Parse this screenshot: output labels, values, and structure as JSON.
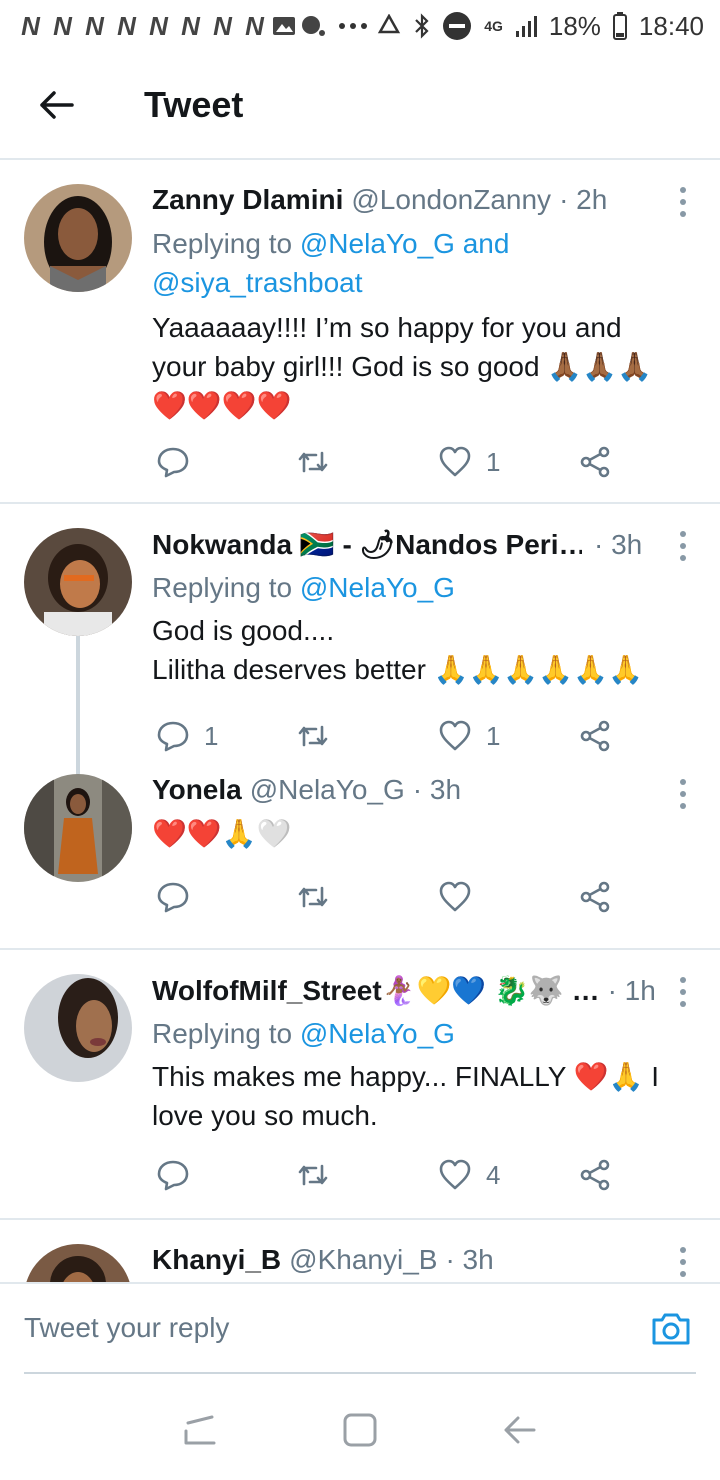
{
  "status_bar": {
    "notif_letters": [
      "N",
      "N",
      "N",
      "N",
      "N",
      "N",
      "N",
      "N"
    ],
    "network": "4G",
    "battery": "18%",
    "time": "18:40"
  },
  "header": {
    "title": "Tweet"
  },
  "tweets": [
    {
      "name": "Zanny Dlamini",
      "handle": "@LondonZanny",
      "time": "· 2h",
      "replying_prefix": "Replying to",
      "mentions_line1": "@NelaYo_G and",
      "mentions_line2": "@siya_trashboat",
      "text_line1": "Yaaaaaay!!!! I’m so happy for you and",
      "text_line2": "your baby girl!!! God is so good 🙏🏾🙏🏾🙏🏾",
      "text_line3": "❤️❤️❤️❤️",
      "reply_count": "",
      "retweet_count": "",
      "like_count": "1"
    },
    {
      "name": "Nokwanda 🇿🇦 - 🌶Nandos Peri…",
      "handle": "",
      "time": "· 3h",
      "replying_prefix": "Replying to",
      "mentions_line1": "@NelaYo_G",
      "text_line1": "God is good....",
      "text_line2": "Lilitha deserves better 🙏🙏🙏🙏🙏🙏",
      "reply_count": "1",
      "retweet_count": "",
      "like_count": "1"
    },
    {
      "name": "Yonela",
      "handle": "@NelaYo_G",
      "time": "· 3h",
      "text_line1": "❤️❤️🙏🤍",
      "reply_count": "",
      "retweet_count": "",
      "like_count": ""
    },
    {
      "name": "WolfofMilf_Street🧜🏾‍♀️💛💙 🐉🐺 …",
      "handle": "",
      "time": "· 1h",
      "replying_prefix": "Replying to",
      "mentions_line1": "@NelaYo_G",
      "text_line1": "This makes me happy... FINALLY ❤️🙏 I",
      "text_line2": "love you so much.",
      "reply_count": "",
      "retweet_count": "",
      "like_count": "4"
    },
    {
      "name": "Khanyi_B",
      "handle": "@Khanyi_B",
      "time": "· 3h"
    }
  ],
  "reply_bar": {
    "placeholder": "Tweet your reply"
  },
  "icons": {
    "back": "back-arrow-icon",
    "more": "more-vertical-icon",
    "reply": "reply-bubble-icon",
    "retweet": "retweet-icon",
    "like": "heart-icon",
    "share": "share-icon",
    "camera": "camera-icon"
  },
  "colors": {
    "link": "#1b95e0",
    "muted": "#657786",
    "divider": "#e1e8ed"
  }
}
